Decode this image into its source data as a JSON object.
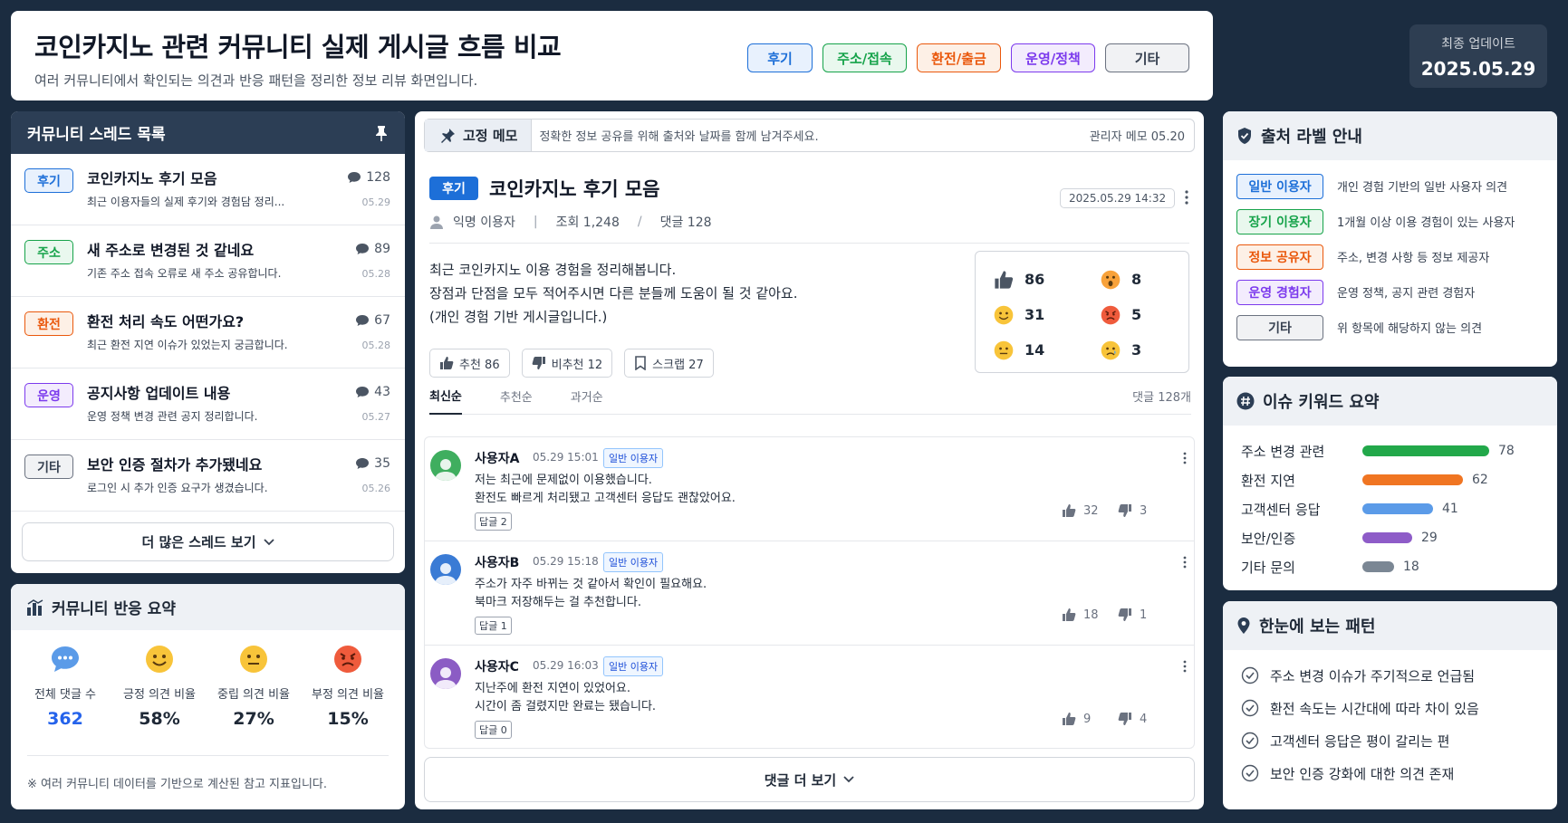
{
  "header": {
    "title": "코인카지노 관련 커뮤니티 실제 게시글 흐름 비교",
    "subtitle": "여러 커뮤니티에서 확인되는 의견과 반응 패턴을 정리한 정보 리뷰 화면입니다.",
    "categories": [
      {
        "label": "후기",
        "color": "#1d6fd8",
        "bg": "#e8f1fd"
      },
      {
        "label": "주소/접속",
        "color": "#16a34a",
        "bg": "#e9f8ee"
      },
      {
        "label": "환전/출금",
        "color": "#ea580c",
        "bg": "#fdf0e6"
      },
      {
        "label": "운영/정책",
        "color": "#7c3aed",
        "bg": "#f3ecfd"
      },
      {
        "label": "기타",
        "color": "#4b5563",
        "bg": "#f1f2f4"
      }
    ],
    "update_label": "최종 업데이트",
    "update_value": "2025.05.29"
  },
  "threads": {
    "title": "커뮤니티 스레드 목록",
    "items": [
      {
        "badge": "후기",
        "color": "#1d6fd8",
        "bg": "#e8f1fd",
        "title": "코인카지노 후기 모음",
        "preview": "최근 이용자들의 실제 후기와 경험담 정리...",
        "comments": "128",
        "date": "05.29"
      },
      {
        "badge": "주소",
        "color": "#16a34a",
        "bg": "#e9f8ee",
        "title": "새 주소로 변경된 것 같네요",
        "preview": "기존 주소 접속 오류로 새 주소 공유합니다.",
        "comments": "89",
        "date": "05.28"
      },
      {
        "badge": "환전",
        "color": "#ea580c",
        "bg": "#fdf0e6",
        "title": "환전 처리 속도 어떤가요?",
        "preview": "최근 환전 지연 이슈가 있었는지 궁금합니다.",
        "comments": "67",
        "date": "05.28"
      },
      {
        "badge": "운영",
        "color": "#7c3aed",
        "bg": "#f3ecfd",
        "title": "공지사항 업데이트 내용",
        "preview": "운영 정책 변경 관련 공지 정리합니다.",
        "comments": "43",
        "date": "05.27"
      },
      {
        "badge": "기타",
        "color": "#4b5563",
        "bg": "#f1f2f4",
        "title": "보안 인증 절차가 추가됐네요",
        "preview": "로그인 시 추가 인증 요구가 생겼습니다.",
        "comments": "35",
        "date": "05.26"
      }
    ],
    "more_label": "더 많은 스레드 보기"
  },
  "summary": {
    "title": "커뮤니티 반응 요약",
    "stats": [
      {
        "icon": "chat-bubble-icon",
        "label": "전체 댓글 수",
        "value": "362",
        "color": "#2563eb"
      },
      {
        "icon": "smile-icon",
        "label": "긍정 의견 비율",
        "value": "58%",
        "color": "#1f2937"
      },
      {
        "icon": "neutral-face-icon",
        "label": "중립 의견 비율",
        "value": "27%",
        "color": "#1f2937"
      },
      {
        "icon": "angry-face-icon",
        "label": "부정 의견 비율",
        "value": "15%",
        "color": "#1f2937"
      }
    ],
    "note": "※ 여러 커뮤니티 데이터를 기반으로 계산된 참고 지표입니다."
  },
  "post": {
    "memo_tag": "고정 메모",
    "memo_text": "정확한 정보 공유를 위해 출처와 날짜를 함께 남겨주세요.",
    "memo_right": "관리자 메모  05.20",
    "badge": "후기",
    "title": "코인카지노 후기 모음",
    "datetime": "2025.05.29 14:32",
    "author": "익명 이용자",
    "views": "조회 1,248",
    "comments": "댓글 128",
    "body": [
      "최근 코인카지노 이용 경험을 정리해봅니다.",
      "장점과 단점을 모두 적어주시면 다른 분들께 도움이 될 것 같아요.",
      "(개인 경험 기반 게시글입니다.)"
    ],
    "actions": [
      {
        "icon": "thumbs-up-icon",
        "label": "추천 86"
      },
      {
        "icon": "thumbs-down-icon",
        "label": "비추천 12"
      },
      {
        "icon": "bookmark-icon",
        "label": "스크랩 27"
      }
    ],
    "reactions": [
      {
        "icon": "thumbs-up-icon",
        "count": "86"
      },
      {
        "icon": "surprised-face-icon",
        "count": "8"
      },
      {
        "icon": "smile-icon",
        "count": "31"
      },
      {
        "icon": "angry-face-icon",
        "count": "5"
      },
      {
        "icon": "neutral-face-icon",
        "count": "14"
      },
      {
        "icon": "sad-face-icon",
        "count": "3"
      }
    ]
  },
  "comments_section": {
    "tabs": [
      "최신순",
      "추천순",
      "과거순"
    ],
    "count_label": "댓글 128개",
    "items": [
      {
        "name": "사용자A",
        "time": "05.29 15:01",
        "label": "일반 이용자",
        "avatar": "#3fae5f",
        "lines": [
          "저는 최근에 문제없이 이용했습니다.",
          "환전도 빠르게 처리됐고 고객센터 응답도 괜찮았어요."
        ],
        "reply": "답글 2",
        "up": "32",
        "down": "3"
      },
      {
        "name": "사용자B",
        "time": "05.29 15:18",
        "label": "일반 이용자",
        "avatar": "#3a7bd5",
        "lines": [
          "주소가 자주 바뀌는 것 같아서 확인이 필요해요.",
          "북마크 저장해두는 걸 추천합니다."
        ],
        "reply": "답글 1",
        "up": "18",
        "down": "1"
      },
      {
        "name": "사용자C",
        "time": "05.29 16:03",
        "label": "일반 이용자",
        "avatar": "#8b5cc4",
        "lines": [
          "지난주에 환전 지연이 있었어요.",
          "시간이 좀 걸렸지만 완료는 됐습니다."
        ],
        "reply": "답글 0",
        "up": "9",
        "down": "4"
      }
    ],
    "more_label": "댓글 더 보기"
  },
  "labels": {
    "title": "출처 라벨 안내",
    "items": [
      {
        "label": "일반 이용자",
        "color": "#1d6fd8",
        "bg": "#e8f1fd",
        "desc": "개인 경험 기반의 일반 사용자 의견"
      },
      {
        "label": "장기 이용자",
        "color": "#16a34a",
        "bg": "#e9f8ee",
        "desc": "1개월 이상 이용 경험이 있는 사용자"
      },
      {
        "label": "정보 공유자",
        "color": "#ea580c",
        "bg": "#fdf0e6",
        "desc": "주소, 변경 사항 등 정보 제공자"
      },
      {
        "label": "운영 경험자",
        "color": "#7c3aed",
        "bg": "#f3ecfd",
        "desc": "운영 정책, 공지 관련 경험자"
      },
      {
        "label": "기타",
        "color": "#4b5563",
        "bg": "#f1f2f4",
        "desc": "위 항목에 해당하지 않는 의견"
      }
    ]
  },
  "keywords": {
    "title": "이슈 키워드 요약",
    "items": [
      {
        "name": "주소 변경 관련",
        "value": "78",
        "color": "#22a84a"
      },
      {
        "name": "환전 지연",
        "value": "62",
        "color": "#f07522"
      },
      {
        "name": "고객센터 응답",
        "value": "41",
        "color": "#5b9be8"
      },
      {
        "name": "보안/인증",
        "value": "29",
        "color": "#8e5cc8"
      },
      {
        "name": "기타 문의",
        "value": "18",
        "color": "#7b8794"
      }
    ]
  },
  "patterns": {
    "title": "한눈에 보는 패턴",
    "items": [
      "주소 변경 이슈가 주기적으로 언급됨",
      "환전 속도는 시간대에 따라 차이 있음",
      "고객센터 응답은 평이 갈리는 편",
      "보안 인증 강화에 대한 의견 존재"
    ]
  }
}
